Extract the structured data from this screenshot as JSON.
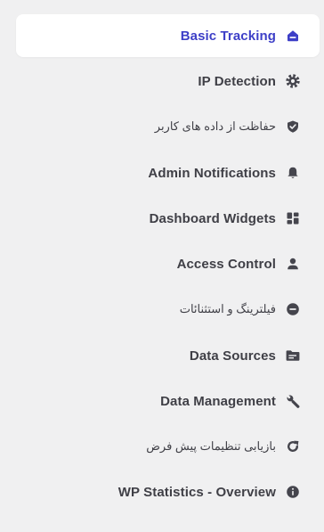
{
  "colors": {
    "background": "#f0f0f1",
    "active_background": "#ffffff",
    "active_text": "#3d3fc7",
    "text": "#3f3f46",
    "icon": "#45454d"
  },
  "menu": {
    "items": [
      {
        "label": "Basic Tracking",
        "icon": "home-icon",
        "active": true
      },
      {
        "label": "IP Detection",
        "icon": "gear-icon",
        "active": false
      },
      {
        "label": "حفاظت از داده های کاربر",
        "icon": "shield-check-icon",
        "active": false
      },
      {
        "label": "Admin Notifications",
        "icon": "bell-icon",
        "active": false
      },
      {
        "label": "Dashboard Widgets",
        "icon": "dashboard-icon",
        "active": false
      },
      {
        "label": "Access Control",
        "icon": "user-icon",
        "active": false
      },
      {
        "label": "فیلترینگ و استثنائات",
        "icon": "minus-circle-icon",
        "active": false
      },
      {
        "label": "Data Sources",
        "icon": "folder-icon",
        "active": false
      },
      {
        "label": "Data Management",
        "icon": "wrench-icon",
        "active": false
      },
      {
        "label": "بازیابی تنظیمات پیش فرض",
        "icon": "reset-icon",
        "active": false
      },
      {
        "label": "WP Statistics - Overview",
        "icon": "info-icon",
        "active": false
      }
    ]
  }
}
